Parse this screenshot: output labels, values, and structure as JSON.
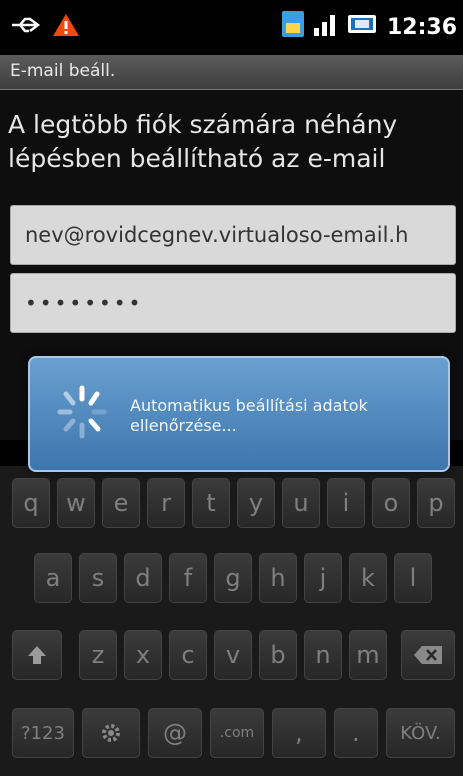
{
  "status_bar": {
    "time": "12:36",
    "icons": [
      "usb-icon",
      "warning-icon",
      "sim-icon",
      "signal-icon",
      "battery-icon"
    ]
  },
  "title_bar": {
    "title": "E-mail beáll."
  },
  "intro": {
    "text": "A legtöbb fiók számára néhány lépésben beállítható az e-mail"
  },
  "fields": {
    "email_value": "nev@rovidcegnev.virtualoso-email.h",
    "password_value": "••••••••"
  },
  "dialog": {
    "message": "Automatikus beállítási adatok ellenőrzése..."
  },
  "keyboard": {
    "row1": [
      "q",
      "w",
      "e",
      "r",
      "t",
      "y",
      "u",
      "i",
      "o",
      "p"
    ],
    "row2": [
      "a",
      "s",
      "d",
      "f",
      "g",
      "h",
      "j",
      "k",
      "l"
    ],
    "row3": [
      "z",
      "x",
      "c",
      "v",
      "b",
      "n",
      "m"
    ],
    "bottom": {
      "sym": "?123",
      "at": "@",
      "com": ".com",
      "comma": ",",
      "dot": ".",
      "next": "KÖV."
    }
  },
  "colors": {
    "dialog": "#4f86bd",
    "field": "#d9d9d9",
    "title_bar": "#4a4a4a"
  }
}
